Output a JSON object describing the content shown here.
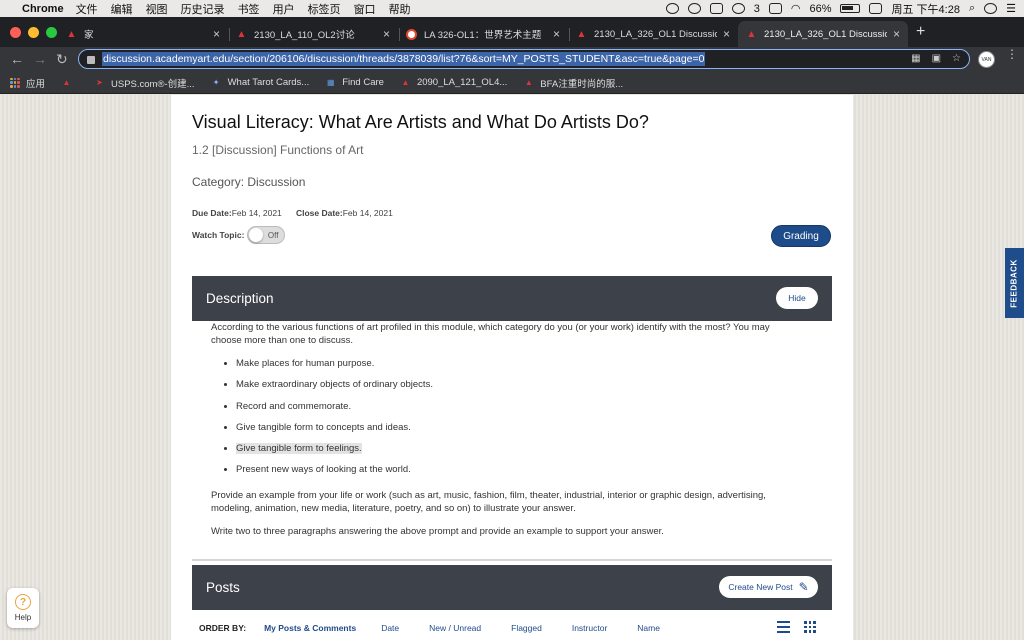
{
  "menubar": {
    "app": "Chrome",
    "items": [
      "文件",
      "编辑",
      "视图",
      "历史记录",
      "书签",
      "用户",
      "标签页",
      "窗口",
      "帮助"
    ],
    "wechat_count": "3",
    "battery": "66%",
    "clock": "周五 下午4:28"
  },
  "tabs": [
    {
      "title": "家"
    },
    {
      "title": "2130_LA_110_OL2讨论"
    },
    {
      "title": "LA 326-OL1：世界艺术主题"
    },
    {
      "title": "2130_LA_326_OL1 Discussion"
    },
    {
      "title": "2130_LA_326_OL1 Discussion"
    }
  ],
  "toolbar": {
    "url": "discussion.academyart.edu/section/206106/discussion/threads/3878039/list?76&sort=MY_POSTS_STUDENT&asc=true&page=0",
    "avatar": "VAN"
  },
  "bookmarks": [
    "应用",
    "USPS.com®-创建...",
    "What Tarot Cards...",
    "Find Care",
    "2090_LA_121_OL4...",
    "BFA注重时尚的服..."
  ],
  "page": {
    "title": "Visual Literacy: What Are Artists and What Do Artists Do?",
    "subtitle": "1.2 [Discussion] Functions of Art",
    "category": "Category: Discussion",
    "due_label": "Due Date:",
    "due_date": "Feb 14, 2021",
    "close_label": "Close Date:",
    "close_date": "Feb 14, 2021",
    "watch_label": "Watch Topic:",
    "watch_state": "Off",
    "grading_label": "Grading"
  },
  "description": {
    "heading": "Description",
    "hide_label": "Hide",
    "intro": "According to the various functions of art profiled in this module, which category do you (or your work) identify with the most? You may choose more than one to discuss.",
    "bullets": [
      "Make places for human purpose.",
      "Make extraordinary objects of ordinary objects.",
      "Record and commemorate.",
      "Give tangible form to concepts and ideas.",
      "Give tangible form to feelings.",
      "Present new ways of looking at the world."
    ],
    "para2": "Provide an example from your life or work (such as art, music, fashion, film, theater, industrial, interior or graphic design, advertising, modeling, animation, new media, literature, poetry, and so on) to illustrate your answer.",
    "para3": "Write two to three paragraphs answering the above prompt and provide an example to support your answer."
  },
  "posts": {
    "heading": "Posts",
    "create_label": "Create New Post",
    "order_by_label": "ORDER BY:",
    "order_options": [
      "My Posts & Comments",
      "Date",
      "New / Unread",
      "Flagged",
      "Instructor",
      "Name"
    ]
  },
  "side": {
    "feedback": "FEEDBACK",
    "help": "Help"
  },
  "colors": {
    "brand_blue": "#1e4b8a",
    "section_bar": "#3d4149"
  }
}
